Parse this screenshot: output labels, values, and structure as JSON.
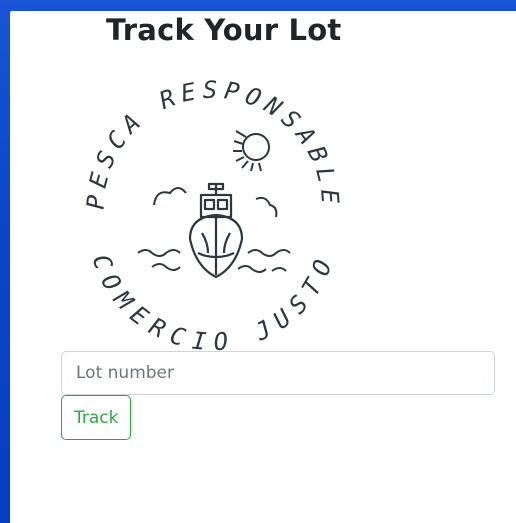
{
  "page": {
    "title": "Track Your Lot"
  },
  "logo": {
    "top_text": "PESCA RESPONSABLE",
    "bottom_text": "COMERCIO JUSTO",
    "icon": "fishing-boat-logo"
  },
  "form": {
    "lot_placeholder": "Lot number",
    "lot_value": "",
    "track_label": "Track"
  },
  "colors": {
    "background_blue": "#0c46c9",
    "title_text": "#212529",
    "button_green": "#28a745",
    "input_border": "#ced4da",
    "logo_ink": "#2f3640"
  }
}
